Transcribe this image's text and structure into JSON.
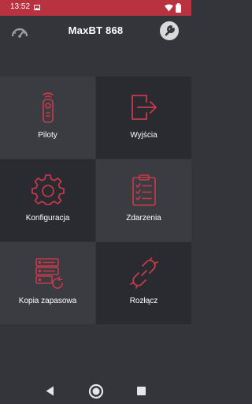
{
  "status_bar": {
    "time": "13:52",
    "icons": [
      "image-icon",
      "wifi-icon",
      "battery-icon"
    ],
    "color": "#b8333f"
  },
  "app_bar": {
    "title": "MaxBT 868",
    "left_icon": "gauge-icon",
    "right_icon": "wrench-settings-icon"
  },
  "tiles": [
    {
      "label": "Piloty",
      "icon": "remote-icon"
    },
    {
      "label": "Wyjścia",
      "icon": "exit-icon"
    },
    {
      "label": "Konfiguracja",
      "icon": "gear-icon"
    },
    {
      "label": "Zdarzenia",
      "icon": "checklist-icon"
    },
    {
      "label": "Kopia zapasowa",
      "icon": "backup-server-icon"
    },
    {
      "label": "Rozłącz",
      "icon": "broken-link-icon"
    }
  ],
  "nav_bar": {
    "icons": [
      "back-icon",
      "home-icon",
      "recents-icon"
    ]
  },
  "colors": {
    "accent": "#c83a4a",
    "background": "#34353a",
    "tile_dark": "#2a2b31",
    "tile_light": "#3b3c42"
  }
}
